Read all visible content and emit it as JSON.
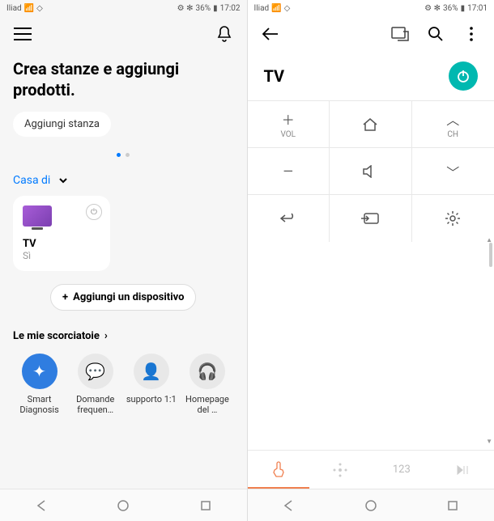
{
  "left": {
    "carrier": "Iliad",
    "battery": "36%",
    "time": "17:02",
    "title": "Crea stanze e aggiungi prodotti.",
    "add_room_label": "Aggiungi stanza",
    "home_label": "Casa di",
    "device": {
      "name": "TV",
      "status": "Sì"
    },
    "add_device_label": "Aggiungi un dispositivo",
    "shortcuts_header": "Le mie scorciatoie",
    "shortcuts": [
      {
        "label": "Smart Diagnosis"
      },
      {
        "label": "Domande frequen…"
      },
      {
        "label": "supporto 1:1"
      },
      {
        "label": "Homepage del …"
      }
    ]
  },
  "right": {
    "carrier": "Iliad",
    "battery": "36%",
    "time": "17:01",
    "title": "TV",
    "vol_label": "VOL",
    "ch_label": "CH",
    "tab_number": "123"
  }
}
